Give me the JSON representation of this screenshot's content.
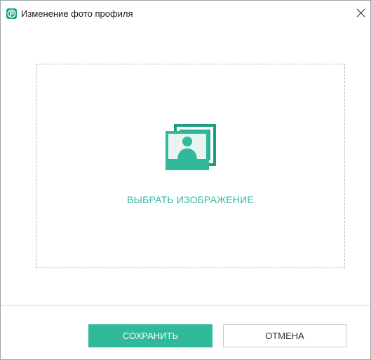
{
  "window": {
    "title": "Изменение фото профиля",
    "app_icon": "p-app-logo-icon",
    "close_icon": "close-icon"
  },
  "dropzone": {
    "icon": "photo-placeholder-icon",
    "select_label": "ВЫБРАТЬ ИЗОБРАЖЕНИЕ"
  },
  "footer": {
    "save_label": "СОХРАНИТЬ",
    "cancel_label": "ОТМЕНА"
  },
  "colors": {
    "accent": "#30b99b",
    "accent_dark": "#17a180",
    "accent_text": "#32b8a0"
  }
}
